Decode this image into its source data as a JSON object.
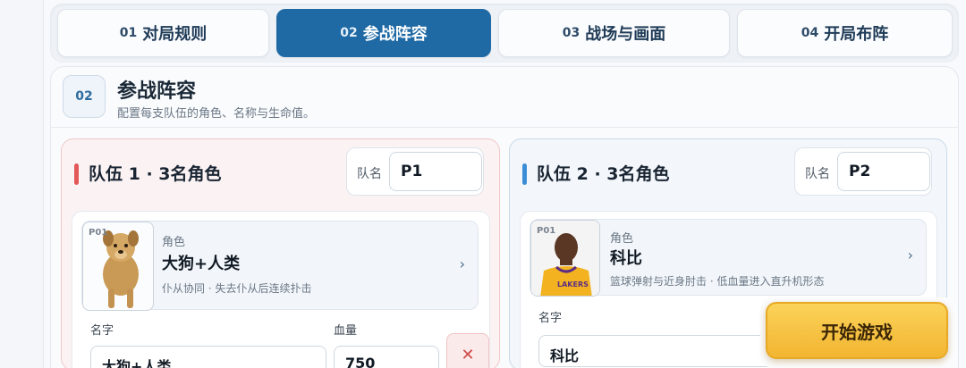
{
  "tabs": [
    {
      "num": "01",
      "label": "对局规则"
    },
    {
      "num": "02",
      "label": "参战阵容"
    },
    {
      "num": "03",
      "label": "战场与画面"
    },
    {
      "num": "04",
      "label": "开局布阵"
    }
  ],
  "active_tab": 1,
  "section": {
    "badge": "02",
    "title": "参战阵容",
    "subtitle": "配置每支队伍的角色、名称与生命值。"
  },
  "team1": {
    "title": "队伍 1 · 3名角色",
    "name_label": "队名",
    "name_value": "P1",
    "character": {
      "slot": "P01",
      "role_label": "角色",
      "role_name": "大狗+人类",
      "description": "仆从协同 · 失去仆从后连续扑击"
    },
    "name_field_label": "名字",
    "name_field_value": "大狗+人类",
    "hp_label": "血量",
    "hp_value": "750",
    "delete_symbol": "✕",
    "accent": "#e25858"
  },
  "team2": {
    "title": "队伍 2 · 3名角色",
    "name_label": "队名",
    "name_value": "P2",
    "character": {
      "slot": "P01",
      "role_label": "角色",
      "role_name": "科比",
      "description": "篮球弹射与近身肘击 · 低血量进入直升机形态"
    },
    "name_field_label": "名字",
    "name_field_value": "科比",
    "accent": "#3b8ed6"
  },
  "start_button": "开始游戏",
  "colors": {
    "primary": "#1f6aa5",
    "start": "#f2b531"
  }
}
